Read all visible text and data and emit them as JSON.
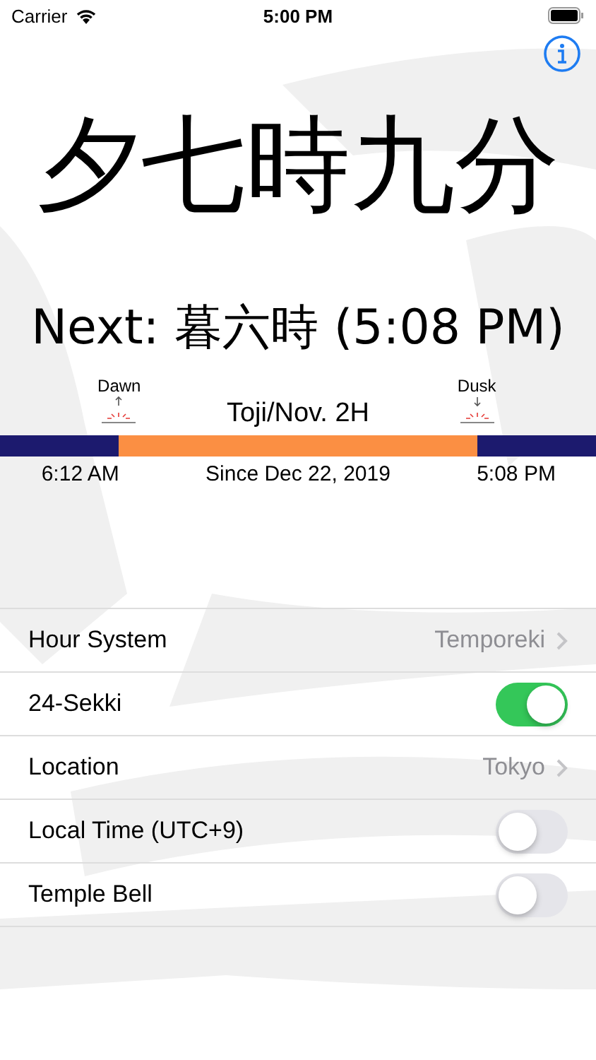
{
  "status_bar": {
    "carrier": "Carrier",
    "time": "5:00 PM"
  },
  "current_hour": "夕七時九分",
  "next": "Next: 暮六時 (5:08 PM)",
  "day_bar": {
    "dawn_label": "Dawn",
    "dusk_label": "Dusk",
    "sekki": "Toji/Nov. 2H",
    "dawn_time": "6:12 AM",
    "since": "Since Dec 22, 2019",
    "dusk_time": "5:08 PM"
  },
  "settings": [
    {
      "kind": "link",
      "label": "Hour System",
      "value": "Temporeki"
    },
    {
      "kind": "toggle",
      "label": "24-Sekki",
      "on": true
    },
    {
      "kind": "link",
      "label": "Location",
      "value": "Tokyo"
    },
    {
      "kind": "toggle",
      "label": "Local Time (UTC+9)",
      "on": false
    },
    {
      "kind": "toggle",
      "label": "Temple Bell",
      "on": false
    }
  ]
}
